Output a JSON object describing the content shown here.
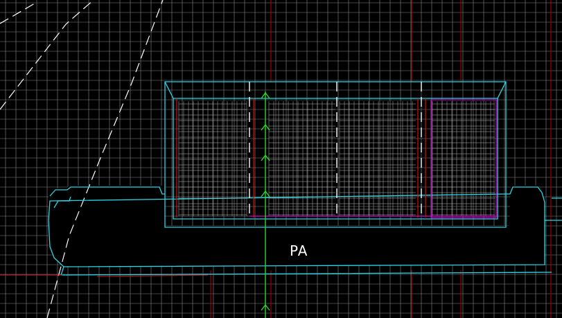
{
  "drawing": {
    "area_label": "PA",
    "colors": {
      "background": "#000000",
      "grid": "#8a8a8a",
      "grid_red": "#b80000",
      "outline": "#29d7e6",
      "hatch": "#b8b8b8",
      "white_dash": "#ffffff",
      "magenta": "#d400d4",
      "axis_green": "#2bd82b",
      "red_edge": "#d21212"
    }
  }
}
